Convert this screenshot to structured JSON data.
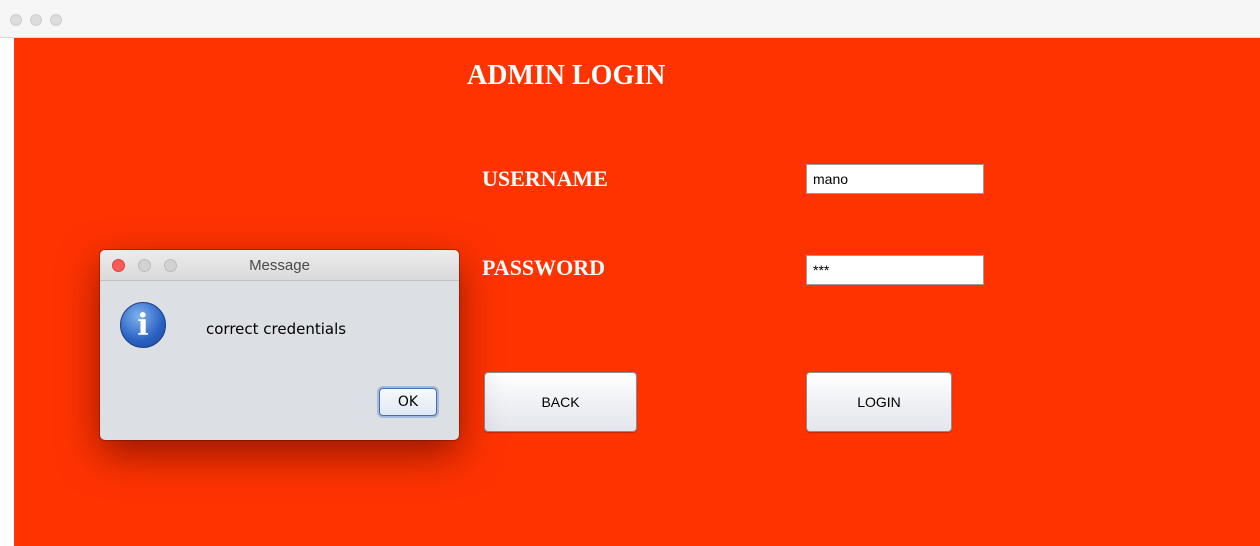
{
  "window": {
    "colors": {
      "background": "#ff3300",
      "label_text": "#ffffff"
    }
  },
  "form": {
    "heading": "ADMIN LOGIN",
    "username_label": "USERNAME",
    "username_value": "mano",
    "password_label": "PASSWORD",
    "password_value": "***",
    "back_label": "BACK",
    "login_label": "LOGIN"
  },
  "dialog": {
    "title": "Message",
    "icon": "info-icon",
    "message": "correct credentials",
    "ok_label": "OK"
  }
}
